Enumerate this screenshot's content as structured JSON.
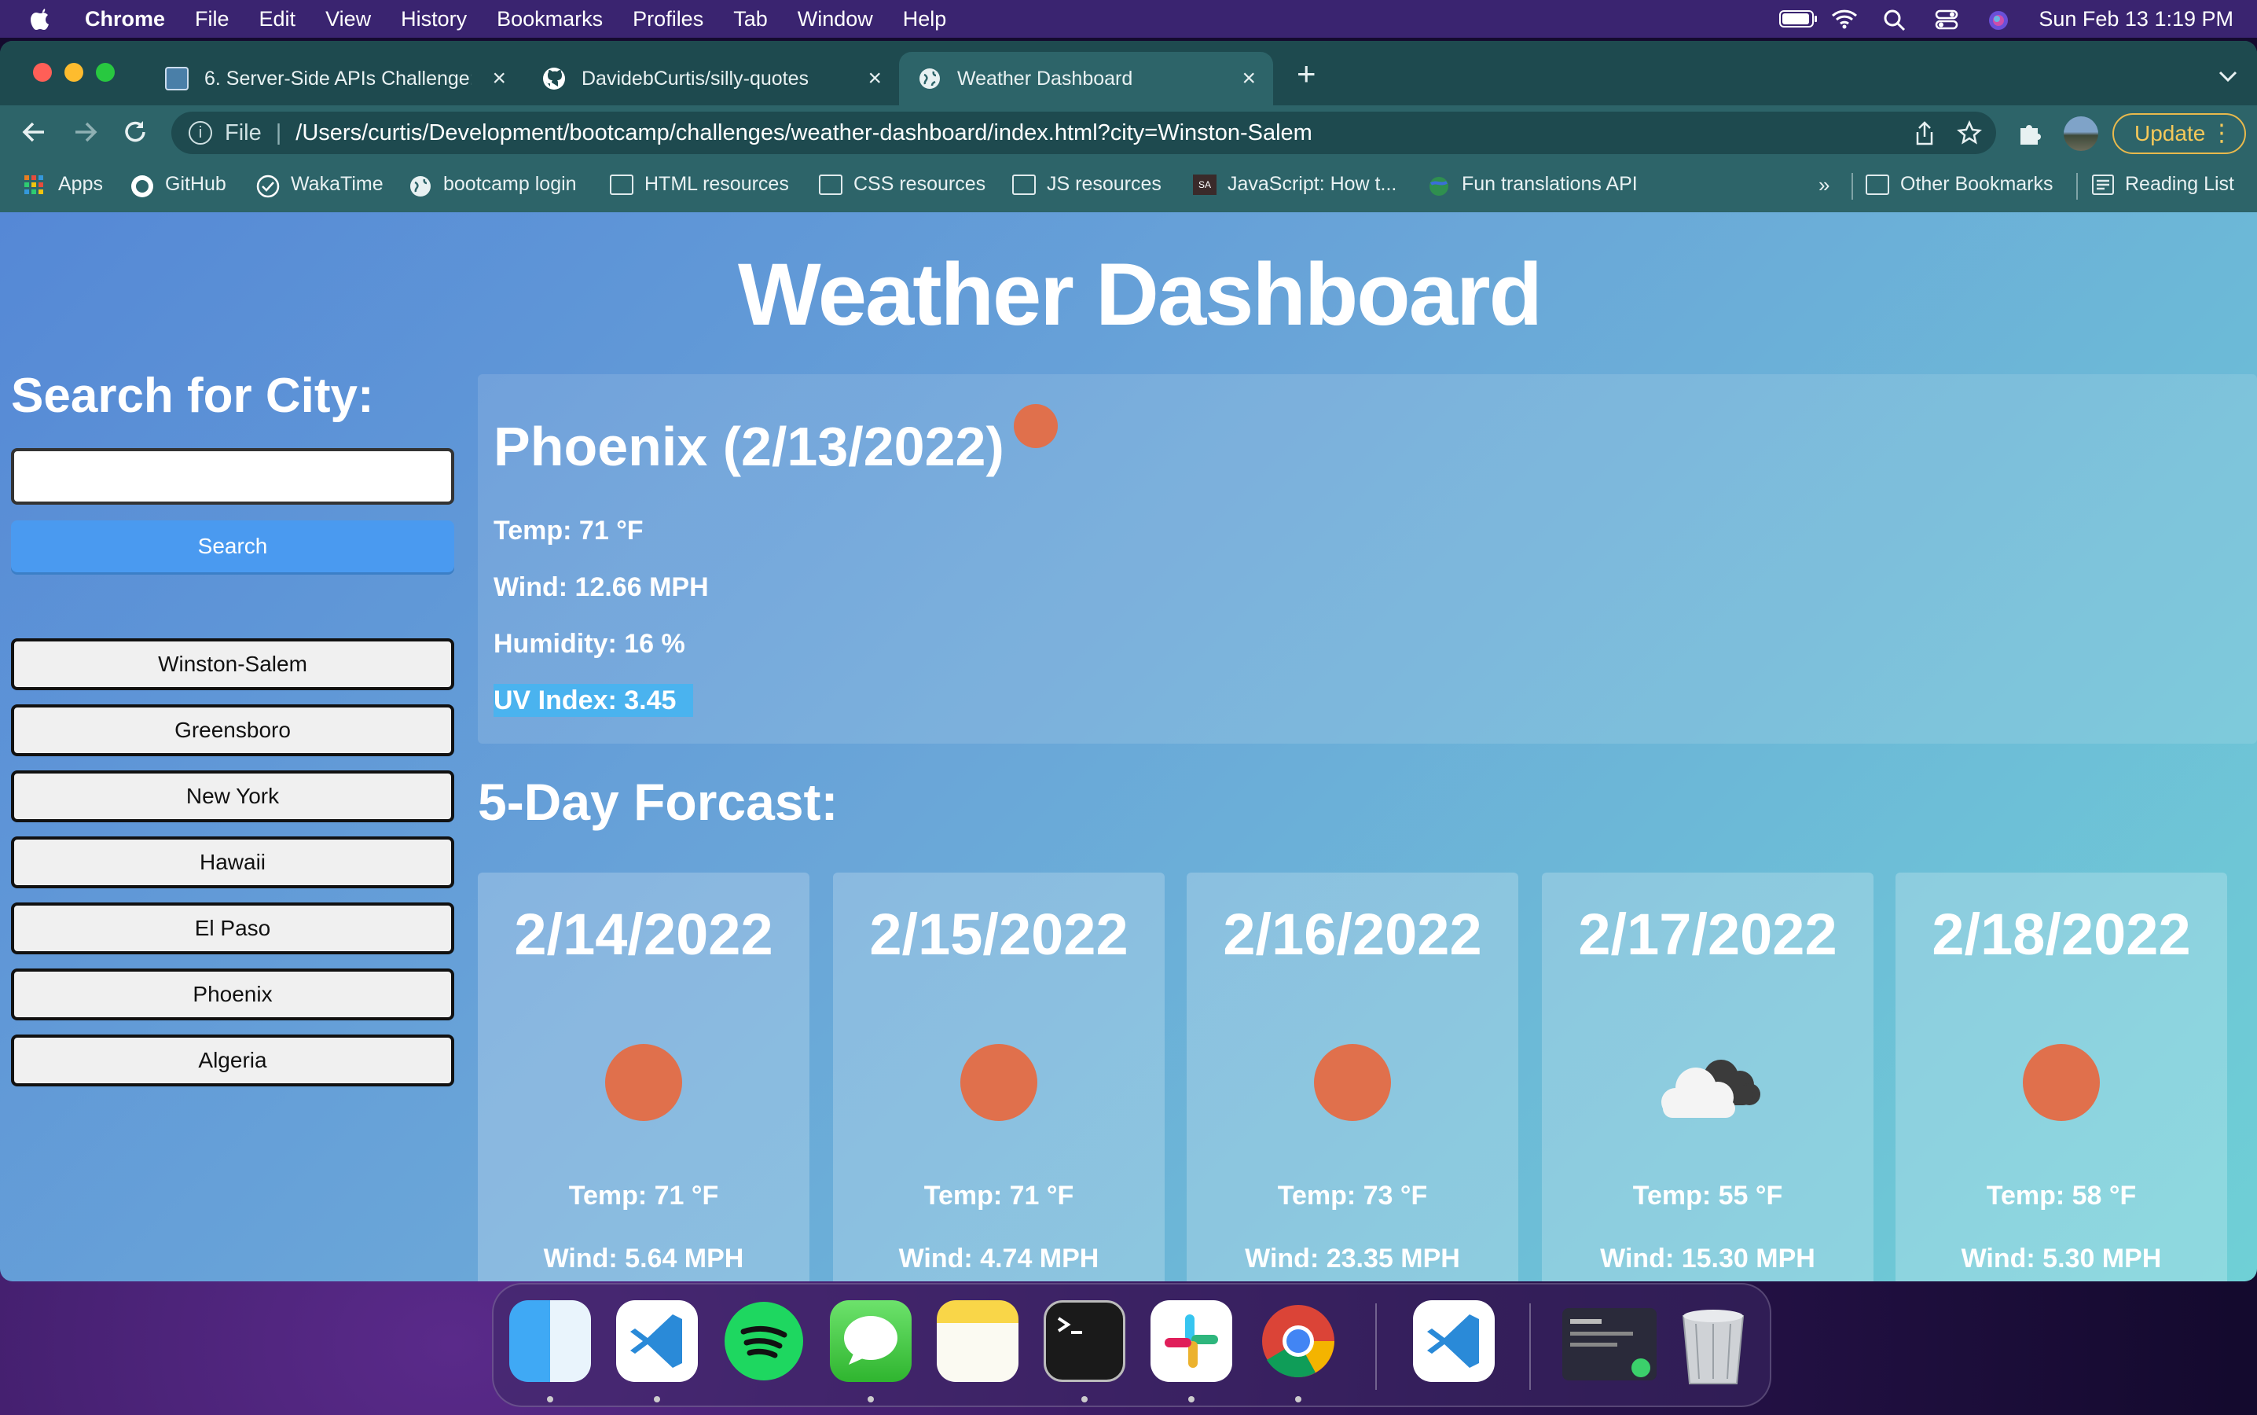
{
  "menubar": {
    "app_name": "Chrome",
    "menus": [
      "File",
      "Edit",
      "View",
      "History",
      "Bookmarks",
      "Profiles",
      "Tab",
      "Window",
      "Help"
    ],
    "clock": "Sun Feb 13  1:19 PM"
  },
  "browser": {
    "tabs": [
      {
        "title": "6. Server-Side APIs Challenge:",
        "active": false
      },
      {
        "title": "DavidebCurtis/silly-quotes",
        "active": false
      },
      {
        "title": "Weather Dashboard",
        "active": true
      }
    ],
    "address": {
      "scheme_label": "File",
      "url": "/Users/curtis/Development/bootcamp/challenges/weather-dashboard/index.html?city=Winston-Salem"
    },
    "update_label": "Update",
    "bookmarks": [
      "Apps",
      "GitHub",
      "WakaTime",
      "bootcamp login",
      "HTML resources",
      "CSS resources",
      "JS resources",
      "JavaScript: How t...",
      "Fun translations API"
    ],
    "overflow_label": "»",
    "other_bookmarks": "Other Bookmarks",
    "reading_list": "Reading List"
  },
  "page": {
    "title": "Weather Dashboard",
    "search": {
      "heading": "Search for City:",
      "input_value": "",
      "button_label": "Search",
      "history": [
        "Winston-Salem",
        "Greensboro",
        "New York",
        "Hawaii",
        "El Paso",
        "Phoenix",
        "Algeria"
      ]
    },
    "current": {
      "heading": "Phoenix (2/13/2022)",
      "temp": "Temp: 71 °F",
      "wind": "Wind: 12.66 MPH",
      "humidity": "Humidity: 16 %",
      "uv": "UV Index: 3.45",
      "icon": "sun-icon",
      "uv_color": "#4ab3ef"
    },
    "forecast": {
      "heading": "5-Day Forcast:",
      "days": [
        {
          "date": "2/14/2022",
          "icon": "sun-icon",
          "temp": "Temp: 71 °F",
          "wind": "Wind: 5.64 MPH"
        },
        {
          "date": "2/15/2022",
          "icon": "sun-icon",
          "temp": "Temp: 71 °F",
          "wind": "Wind: 4.74 MPH"
        },
        {
          "date": "2/16/2022",
          "icon": "sun-icon",
          "temp": "Temp: 73 °F",
          "wind": "Wind: 23.35 MPH"
        },
        {
          "date": "2/17/2022",
          "icon": "cloud-icon",
          "temp": "Temp: 55 °F",
          "wind": "Wind: 15.30 MPH"
        },
        {
          "date": "2/18/2022",
          "icon": "sun-icon",
          "temp": "Temp: 58 °F",
          "wind": "Wind: 5.30 MPH"
        }
      ]
    }
  },
  "dock": {
    "apps": [
      "finder-icon",
      "vscode-icon",
      "spotify-icon",
      "messages-icon",
      "notes-icon",
      "terminal-icon",
      "slack-icon",
      "chrome-icon",
      "vscode-icon",
      "screenshot-icon",
      "trash-icon"
    ]
  },
  "colors": {
    "accent": "#4a9af0",
    "sun": "#e0704c",
    "update": "#e9b94c"
  }
}
